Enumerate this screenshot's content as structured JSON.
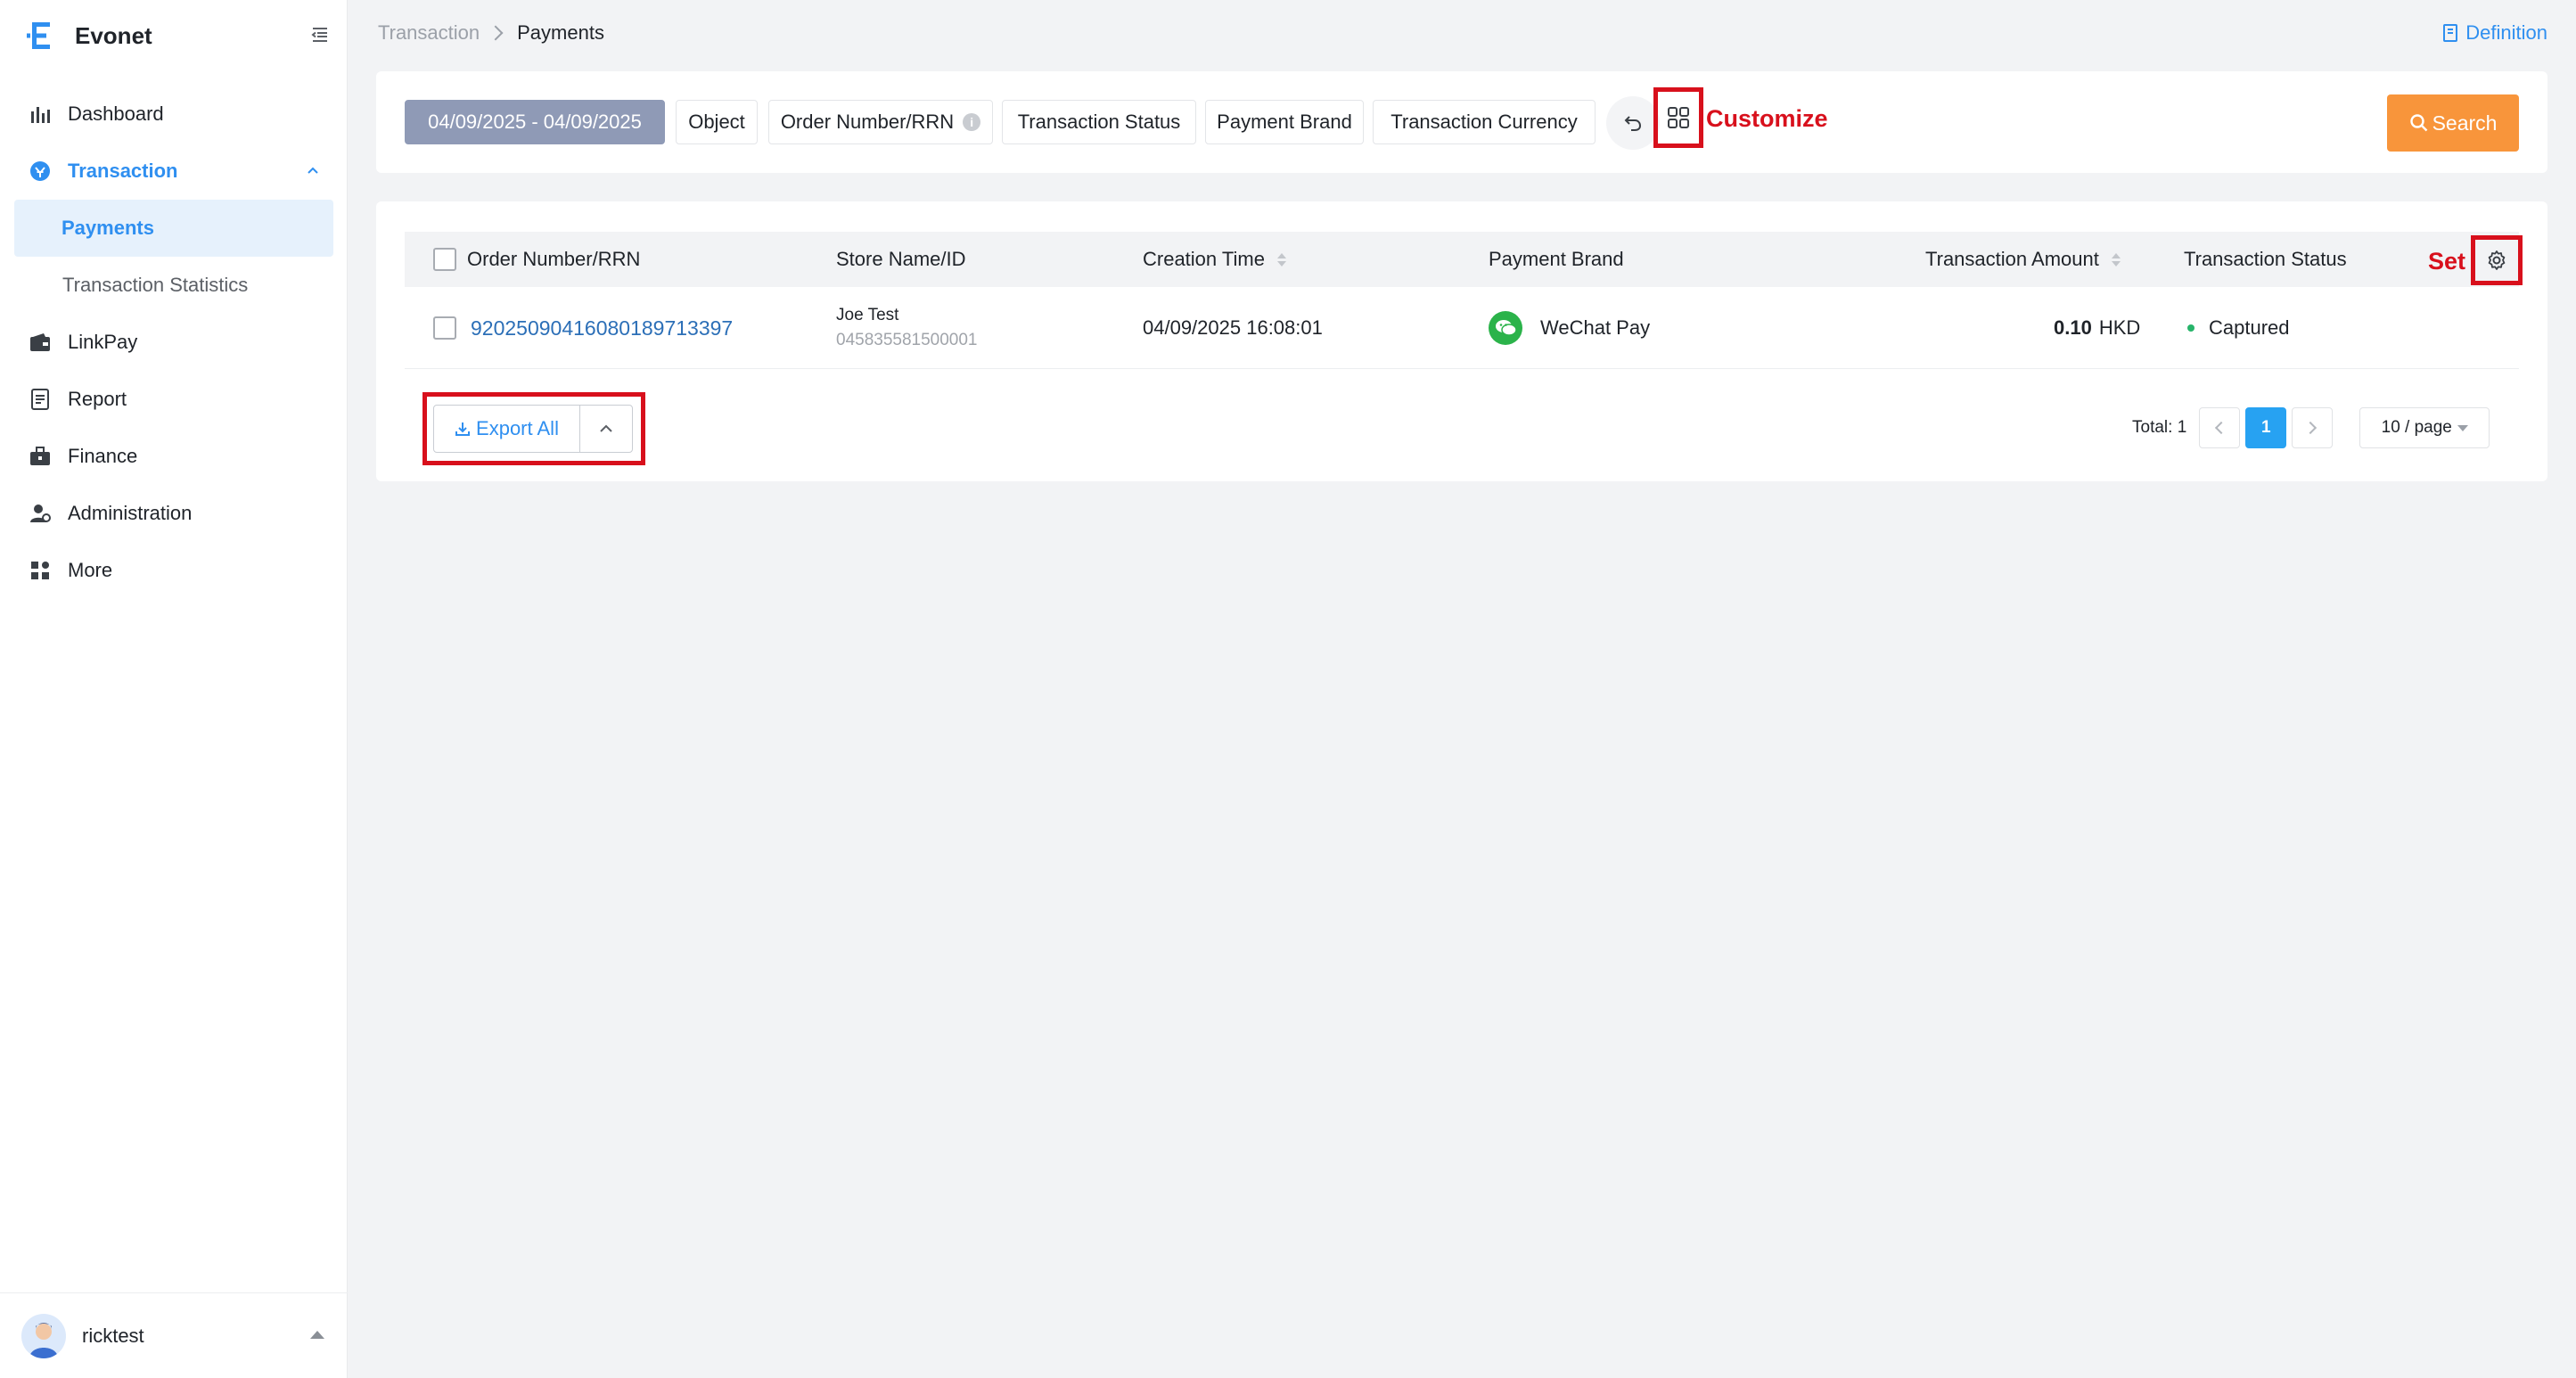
{
  "app": {
    "name": "Evonet"
  },
  "sidebar": {
    "items": [
      {
        "label": "Dashboard",
        "icon": "bar-chart-icon"
      },
      {
        "label": "Transaction",
        "icon": "transaction-icon",
        "expanded": true,
        "children": [
          {
            "label": "Payments",
            "selected": true
          },
          {
            "label": "Transaction Statistics"
          }
        ]
      },
      {
        "label": "LinkPay",
        "icon": "wallet-icon"
      },
      {
        "label": "Report",
        "icon": "report-icon"
      },
      {
        "label": "Finance",
        "icon": "finance-icon"
      },
      {
        "label": "Administration",
        "icon": "admin-icon"
      },
      {
        "label": "More",
        "icon": "grid-icon"
      }
    ],
    "user": {
      "name": "ricktest"
    }
  },
  "breadcrumb": {
    "parent": "Transaction",
    "current": "Payments"
  },
  "header": {
    "definition_label": "Definition"
  },
  "filters": {
    "date_range": "04/09/2025 - 04/09/2025",
    "chips": [
      "Object",
      "Order Number/RRN",
      "Transaction Status",
      "Payment Brand",
      "Transaction Currency"
    ],
    "order_info_glyph": "i",
    "customize_label": "Customize",
    "search_label": "Search"
  },
  "table": {
    "columns": [
      "Order Number/RRN",
      "Store Name/ID",
      "Creation Time",
      "Payment Brand",
      "Transaction Amount",
      "Transaction Status"
    ],
    "set_label": "Set",
    "rows": [
      {
        "order_number": "92025090416080189713397",
        "store_name": "Joe Test",
        "store_id": "045835581500001",
        "creation_time": "04/09/2025 16:08:01",
        "payment_brand": "WeChat Pay",
        "amount": "0.10",
        "currency": "HKD",
        "status": "Captured"
      }
    ]
  },
  "footer": {
    "export_label": "Export All",
    "total_label": "Total: 1",
    "current_page": "1",
    "page_size": "10 / page"
  },
  "colors": {
    "accent": "#2f8ff0",
    "search": "#f8953b",
    "highlight": "#d8101c",
    "status_captured": "#27b46a"
  }
}
